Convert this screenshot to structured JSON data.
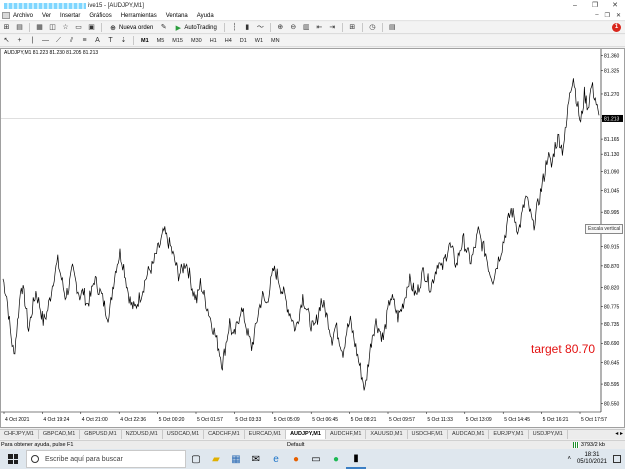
{
  "window": {
    "title": "ive15 - [AUDJPY,M1]",
    "controls": [
      "–",
      "❐",
      "✕"
    ]
  },
  "menu": {
    "items": [
      "Archivo",
      "Ver",
      "Insertar",
      "Gráficos",
      "Herramientas",
      "Ventana",
      "Ayuda"
    ],
    "right_controls": [
      "–",
      "❐",
      "✕"
    ]
  },
  "toolbar1": {
    "new_order_label": "Nueva orden",
    "autotrading_label": "AutoTrading",
    "alert_count": "1"
  },
  "toolbar2": {
    "timeframes": [
      "M1",
      "M5",
      "M15",
      "M30",
      "H1",
      "H4",
      "D1",
      "W1",
      "MN"
    ],
    "active_timeframe": "M1"
  },
  "chart": {
    "header": "AUDJPY,M1  81.223 81.230 81.205 81.213",
    "price_labels": [
      "81.360",
      "81.325",
      "81.270",
      "81.213",
      "81.165",
      "81.130",
      "81.090",
      "81.045",
      "80.995",
      "80.950",
      "80.915",
      "80.870",
      "80.820",
      "80.775",
      "80.735",
      "80.690",
      "80.645",
      "80.595",
      "80.550"
    ],
    "current_price": "81.213",
    "time_labels": [
      "4 Oct 2021",
      "4 Oct 19:24",
      "4 Oct 21:00",
      "4 Oct 22:36",
      "5 Oct 00:20",
      "5 Oct 01:57",
      "5 Oct 03:33",
      "5 Oct 05:09",
      "5 Oct 06:45",
      "5 Oct 08:21",
      "5 Oct 09:57",
      "5 Oct 11:33",
      "5 Oct 13:09",
      "5 Oct 14:45",
      "5 Oct 16:21",
      "5 Oct 17:57"
    ],
    "tooltip": "Escala vertical",
    "annotation": "target 80.70",
    "annotation_color": "#e31212"
  },
  "chart_data": {
    "type": "line",
    "title": "AUDJPY,M1",
    "ylim": [
      80.53,
      81.37
    ],
    "y": [
      80.84,
      80.8,
      80.72,
      80.66,
      80.74,
      80.83,
      80.79,
      80.72,
      80.77,
      80.81,
      80.78,
      80.74,
      80.76,
      80.8,
      80.85,
      80.88,
      80.84,
      80.8,
      80.82,
      80.86,
      80.83,
      80.8,
      80.81,
      80.78,
      80.8,
      80.84,
      80.82,
      80.8,
      80.77,
      80.75,
      80.82,
      80.87,
      80.9,
      80.87,
      80.82,
      80.78,
      80.77,
      80.79,
      80.81,
      80.84,
      80.86,
      80.87,
      80.9,
      80.92,
      80.95,
      80.93,
      80.91,
      80.88,
      80.85,
      80.86,
      80.88,
      80.85,
      80.81,
      80.79,
      80.83,
      80.8,
      80.77,
      80.74,
      80.71,
      80.68,
      80.64,
      80.69,
      80.74,
      80.7,
      80.73,
      80.77,
      80.75,
      80.71,
      80.68,
      80.72,
      80.77,
      80.8,
      80.78,
      80.82,
      80.86,
      80.85,
      80.82,
      80.8,
      80.77,
      80.75,
      80.72,
      80.76,
      80.8,
      80.77,
      80.74,
      80.72,
      80.75,
      80.79,
      80.77,
      80.74,
      80.7,
      80.73,
      80.7,
      80.67,
      80.72,
      80.74,
      80.7,
      80.66,
      80.62,
      80.58,
      80.65,
      80.71,
      80.74,
      80.72,
      80.7,
      80.75,
      80.8,
      80.78,
      80.75,
      80.77,
      80.8,
      80.84,
      80.82,
      80.8,
      80.83,
      80.86,
      80.84,
      80.82,
      80.85,
      80.88,
      80.86,
      80.89,
      80.92,
      80.9,
      80.87,
      80.91,
      80.93,
      80.9,
      80.88,
      80.91,
      80.95,
      80.92,
      80.9,
      80.86,
      80.84,
      80.87,
      80.9,
      80.93,
      80.97,
      81.0,
      80.98,
      80.95,
      80.99,
      81.03,
      81.0,
      80.96,
      81.0,
      81.04,
      81.08,
      81.13,
      81.1,
      81.15,
      81.17,
      81.14,
      81.19,
      81.28,
      81.31,
      81.25,
      81.2,
      81.27,
      81.24,
      81.29,
      81.26,
      81.21
    ],
    "grid": false
  },
  "tabs": {
    "items": [
      "CHFJPY,M1",
      "GBPCAD,M1",
      "GBPUSD,M1",
      "NZDUSD,M1",
      "USDCAD,M1",
      "CADCHF,M1",
      "EURCAD,M1",
      "AUDJPY,M1",
      "AUDCHF,M1",
      "XAUUSD,M1",
      "USDCHF,M1",
      "AUDCAD,M1",
      "EURJPY,M1",
      "USDJPY,M1"
    ],
    "active": "AUDJPY,M1"
  },
  "status": {
    "help": "Para obtener ayuda, pulse F1",
    "profile": "Default",
    "traffic": "3793/2 kb"
  },
  "taskbar": {
    "search_placeholder": "Escribe aquí para buscar",
    "time": "18:31",
    "date": "05/10/2021"
  }
}
